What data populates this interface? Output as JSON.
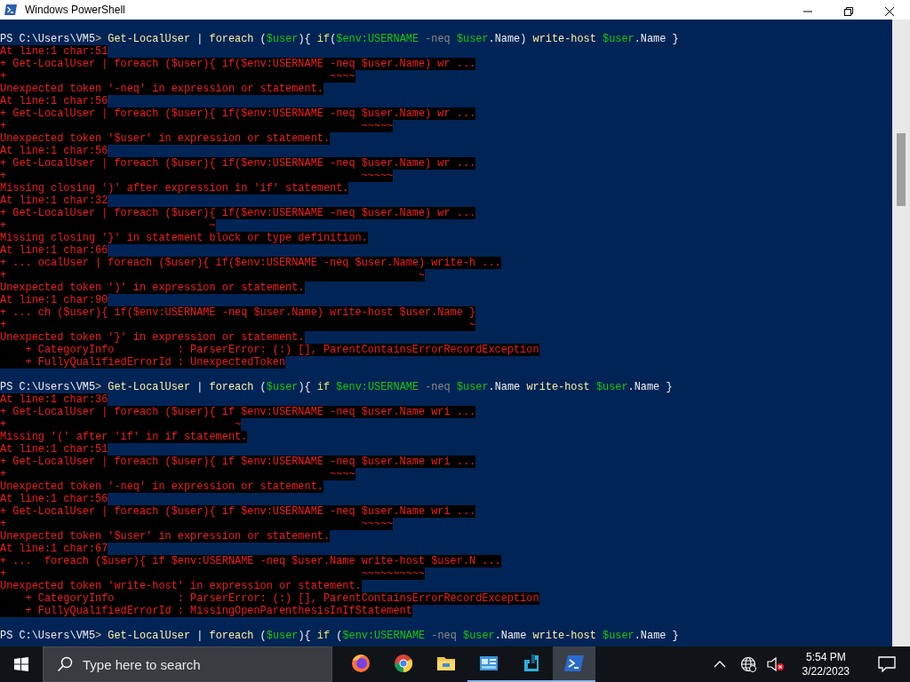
{
  "window": {
    "title": "Windows PowerShell"
  },
  "console": {
    "lines": [
      {
        "kind": "blank"
      },
      {
        "kind": "prompt",
        "tokens": [
          {
            "kind": "text",
            "text": "PS C:\\Users\\VM5"
          },
          {
            "kind": "marker",
            "text": "> "
          },
          {
            "kind": "command",
            "text": "Get-LocalUser"
          },
          {
            "kind": "text",
            "text": " | "
          },
          {
            "kind": "command",
            "text": "foreach"
          },
          {
            "kind": "text",
            "text": " ("
          },
          {
            "kind": "variable",
            "text": "$user"
          },
          {
            "kind": "text",
            "text": "){ "
          },
          {
            "kind": "keyword",
            "text": "if"
          },
          {
            "kind": "text",
            "text": "("
          },
          {
            "kind": "variable",
            "text": "$env:USERNAME"
          },
          {
            "kind": "operator",
            "text": " -neq "
          },
          {
            "kind": "variable",
            "text": "$user"
          },
          {
            "kind": "text",
            "text": ".Name) "
          },
          {
            "kind": "command",
            "text": "write-host "
          },
          {
            "kind": "variable",
            "text": "$user"
          },
          {
            "kind": "text",
            "text": ".Name }"
          }
        ]
      },
      {
        "kind": "error",
        "text": "At line:1 char:51"
      },
      {
        "kind": "error",
        "text": "+ Get-LocalUser | foreach ($user){ if($env:USERNAME -neq $user.Name) wr ..."
      },
      {
        "kind": "error",
        "text": "+                                                   ~~~~"
      },
      {
        "kind": "error",
        "text": "Unexpected token '-neq' in expression or statement."
      },
      {
        "kind": "error",
        "text": "At line:1 char:56"
      },
      {
        "kind": "error",
        "text": "+ Get-LocalUser | foreach ($user){ if($env:USERNAME -neq $user.Name) wr ..."
      },
      {
        "kind": "error",
        "text": "+                                                        ~~~~~"
      },
      {
        "kind": "error",
        "text": "Unexpected token '$user' in expression or statement."
      },
      {
        "kind": "error",
        "text": "At line:1 char:56"
      },
      {
        "kind": "error",
        "text": "+ Get-LocalUser | foreach ($user){ if($env:USERNAME -neq $user.Name) wr ..."
      },
      {
        "kind": "error",
        "text": "+                                                        ~~~~~"
      },
      {
        "kind": "error",
        "text": "Missing closing ')' after expression in 'if' statement."
      },
      {
        "kind": "error",
        "text": "At line:1 char:32"
      },
      {
        "kind": "error",
        "text": "+ Get-LocalUser | foreach ($user){ if($env:USERNAME -neq $user.Name) wr ..."
      },
      {
        "kind": "error",
        "text": "+                                ~"
      },
      {
        "kind": "error",
        "text": "Missing closing '}' in statement block or type definition."
      },
      {
        "kind": "error",
        "text": "At line:1 char:66"
      },
      {
        "kind": "error",
        "text": "+ ... ocalUser | foreach ($user){ if($env:USERNAME -neq $user.Name) write-h ..."
      },
      {
        "kind": "error",
        "text": "+                                                                 ~"
      },
      {
        "kind": "error",
        "text": "Unexpected token ')' in expression or statement."
      },
      {
        "kind": "error",
        "text": "At line:1 char:90"
      },
      {
        "kind": "error",
        "text": "+ ... ch ($user){ if($env:USERNAME -neq $user.Name) write-host $user.Name }"
      },
      {
        "kind": "error",
        "text": "+                                                                         ~"
      },
      {
        "kind": "error",
        "text": "Unexpected token '}' in expression or statement."
      },
      {
        "kind": "error",
        "text": "    + CategoryInfo          : ParserError: (:) [], ParentContainsErrorRecordException"
      },
      {
        "kind": "error",
        "text": "    + FullyQualifiedErrorId : UnexpectedToken"
      },
      {
        "kind": "blank"
      },
      {
        "kind": "prompt",
        "tokens": [
          {
            "kind": "text",
            "text": "PS C:\\Users\\VM5"
          },
          {
            "kind": "marker",
            "text": "> "
          },
          {
            "kind": "command",
            "text": "Get-LocalUser"
          },
          {
            "kind": "text",
            "text": " | "
          },
          {
            "kind": "command",
            "text": "foreach"
          },
          {
            "kind": "text",
            "text": " ("
          },
          {
            "kind": "variable",
            "text": "$user"
          },
          {
            "kind": "text",
            "text": "){ "
          },
          {
            "kind": "keyword",
            "text": "if "
          },
          {
            "kind": "variable",
            "text": "$env:USERNAME"
          },
          {
            "kind": "operator",
            "text": " -neq "
          },
          {
            "kind": "variable",
            "text": "$user"
          },
          {
            "kind": "text",
            "text": ".Name "
          },
          {
            "kind": "command",
            "text": "write-host "
          },
          {
            "kind": "variable",
            "text": "$user"
          },
          {
            "kind": "text",
            "text": ".Name }"
          }
        ]
      },
      {
        "kind": "error",
        "text": "At line:1 char:36"
      },
      {
        "kind": "error",
        "text": "+ Get-LocalUser | foreach ($user){ if $env:USERNAME -neq $user.Name wri ..."
      },
      {
        "kind": "error",
        "text": "+                                    ~"
      },
      {
        "kind": "error",
        "text": "Missing '(' after 'if' in if statement."
      },
      {
        "kind": "error",
        "text": "At line:1 char:51"
      },
      {
        "kind": "error",
        "text": "+ Get-LocalUser | foreach ($user){ if $env:USERNAME -neq $user.Name wri ..."
      },
      {
        "kind": "error",
        "text": "+                                                   ~~~~"
      },
      {
        "kind": "error",
        "text": "Unexpected token '-neq' in expression or statement."
      },
      {
        "kind": "error",
        "text": "At line:1 char:56"
      },
      {
        "kind": "error",
        "text": "+ Get-LocalUser | foreach ($user){ if $env:USERNAME -neq $user.Name wri ..."
      },
      {
        "kind": "error",
        "text": "+                                                        ~~~~~"
      },
      {
        "kind": "error",
        "text": "Unexpected token '$user' in expression or statement."
      },
      {
        "kind": "error",
        "text": "At line:1 char:67"
      },
      {
        "kind": "error",
        "text": "+ ...  foreach ($user){ if $env:USERNAME -neq $user.Name write-host $user.N ..."
      },
      {
        "kind": "error",
        "text": "+                                                        ~~~~~~~~~~"
      },
      {
        "kind": "error",
        "text": "Unexpected token 'write-host' in expression or statement."
      },
      {
        "kind": "error",
        "text": "    + CategoryInfo          : ParserError: (:) [], ParentContainsErrorRecordException"
      },
      {
        "kind": "error",
        "text": "    + FullyQualifiedErrorId : MissingOpenParenthesisInIfStatement"
      },
      {
        "kind": "blank"
      },
      {
        "kind": "prompt",
        "tokens": [
          {
            "kind": "text",
            "text": "PS C:\\Users\\VM5"
          },
          {
            "kind": "marker",
            "text": "> "
          },
          {
            "kind": "command",
            "text": "Get-LocalUser"
          },
          {
            "kind": "text",
            "text": " | "
          },
          {
            "kind": "command",
            "text": "foreach"
          },
          {
            "kind": "text",
            "text": " ("
          },
          {
            "kind": "variable",
            "text": "$user"
          },
          {
            "kind": "text",
            "text": "){ "
          },
          {
            "kind": "keyword",
            "text": "if"
          },
          {
            "kind": "text",
            "text": " ("
          },
          {
            "kind": "variable",
            "text": "$env:USERNAME"
          },
          {
            "kind": "operator",
            "text": " -neq "
          },
          {
            "kind": "variable",
            "text": "$user"
          },
          {
            "kind": "text",
            "text": ".Name "
          },
          {
            "kind": "command",
            "text": "write-host "
          },
          {
            "kind": "variable",
            "text": "$user"
          },
          {
            "kind": "text",
            "text": ".Name }"
          }
        ]
      }
    ]
  },
  "taskbar": {
    "search": {
      "placeholder": "Type here to search"
    },
    "apps": [
      {
        "kind": "fox",
        "running": false,
        "selected": false
      },
      {
        "kind": "wheel",
        "running": false,
        "selected": false
      },
      {
        "kind": "folder",
        "running": false,
        "selected": false
      },
      {
        "kind": "window",
        "running": true,
        "selected": false
      },
      {
        "kind": "tool",
        "running": true,
        "selected": false
      },
      {
        "kind": "shell",
        "running": true,
        "selected": true
      }
    ],
    "clock": {
      "time": "5:54 PM",
      "date": "3/22/2023"
    }
  }
}
